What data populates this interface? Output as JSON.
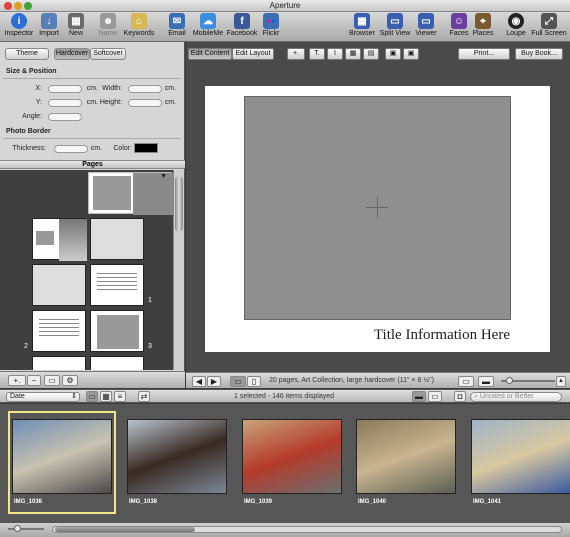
{
  "app": {
    "title": "Aperture"
  },
  "toolbar": {
    "items": [
      {
        "label": "Inspector",
        "icon": "i",
        "color": "#2b6fd6"
      },
      {
        "label": "Import",
        "icon": "↓",
        "color": "#5a7fb8"
      },
      {
        "label": "New",
        "icon": "▦",
        "color": "#6a6a6a"
      },
      {
        "label": "Name",
        "icon": "👤",
        "color": "#9a9a9a"
      },
      {
        "label": "Keywords",
        "icon": "⌂",
        "color": "#d8b850"
      },
      {
        "label": "Email",
        "icon": "✉",
        "color": "#3a6fb5"
      },
      {
        "label": "MobileMe",
        "icon": "☁",
        "color": "#3b8de0"
      },
      {
        "label": "Facebook",
        "icon": "f",
        "color": "#3b5998"
      },
      {
        "label": "Flickr",
        "icon": "●●",
        "color": "#3a6fb5"
      },
      {
        "label": "Browser",
        "icon": "▦",
        "color": "#3a5fb0"
      },
      {
        "label": "Split View",
        "icon": "▭",
        "color": "#3a5fb0"
      },
      {
        "label": "Viewer",
        "icon": "▭",
        "color": "#3a5fb0"
      },
      {
        "label": "Faces",
        "icon": "☺",
        "color": "#6a3fa0"
      },
      {
        "label": "Places",
        "icon": "⌖",
        "color": "#7a5a30"
      },
      {
        "label": "Loupe",
        "icon": "◉",
        "color": "#222222"
      },
      {
        "label": "Full Screen",
        "icon": "⤢",
        "color": "#555555"
      }
    ]
  },
  "left": {
    "tabs": {
      "theme": "Theme",
      "hardcover": "Hardcover",
      "softcover": "Softcover"
    },
    "size_section": "Size & Position",
    "x_label": "X:",
    "y_label": "Y:",
    "width_label": "Width:",
    "height_label": "Height:",
    "angle_label": "Angle:",
    "unit": "cm.",
    "border_section": "Photo Border",
    "thickness_label": "Thickness:",
    "color_label": "Color:",
    "pages_title": "Pages",
    "page_numbers": [
      "1",
      "2",
      "3"
    ],
    "bottom": {
      "add": "+.",
      "remove": "−"
    }
  },
  "editor": {
    "edit_content": "Edit Content",
    "edit_layout": "Edit Layout",
    "print": "Print...",
    "buy_book": "Buy Book...",
    "page_title": "Title Information Here",
    "status": "20 pages, Art Collection, large hardcover (11\" × 8 ½\")"
  },
  "browser": {
    "sort": "Date",
    "selection": "1 selected - 146 items displayed",
    "rating_filter": "Unrated or Better",
    "images": [
      {
        "name": "IMG_1036",
        "colors": [
          "#6f8fb5",
          "#c9c2b0",
          "#4a4a4a"
        ]
      },
      {
        "name": "IMG_1038",
        "colors": [
          "#b9c4cf",
          "#3a2a22",
          "#7a8796"
        ]
      },
      {
        "name": "IMG_1039",
        "colors": [
          "#c8a47a",
          "#b53a2a",
          "#6a6f72"
        ]
      },
      {
        "name": "IMG_1040",
        "colors": [
          "#8a7a5a",
          "#c8b490",
          "#5a5f52"
        ]
      },
      {
        "name": "IMG_1041",
        "colors": [
          "#9fb4c9",
          "#d8c8a0",
          "#3a5aa0"
        ]
      }
    ]
  }
}
